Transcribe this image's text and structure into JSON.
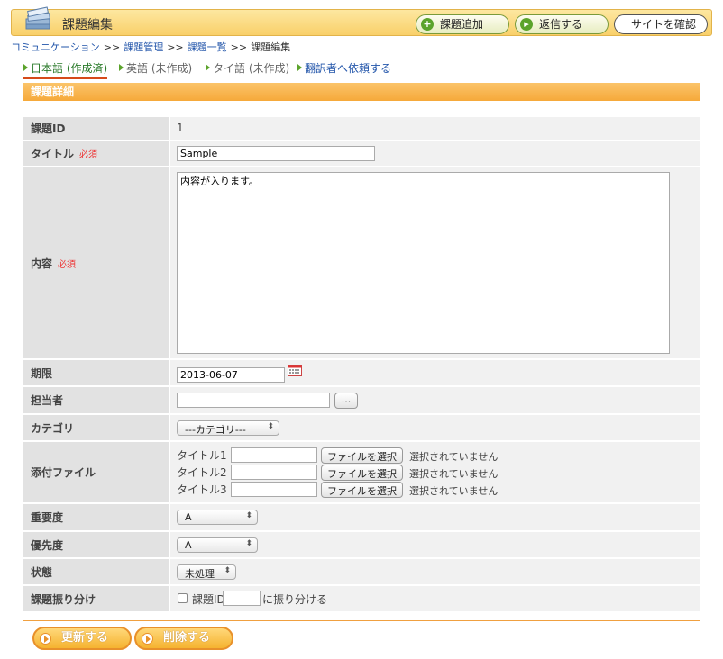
{
  "header": {
    "title": "課題編集",
    "buttons": {
      "add_task": "課題追加",
      "reply": "返信する",
      "view_site": "サイトを確認"
    }
  },
  "breadcrumb": {
    "items": [
      "コミュニケーション",
      "課題管理",
      "課題一覧",
      "課題編集"
    ],
    "separator": ">>"
  },
  "tabs": [
    {
      "label": "日本語 (作成済)"
    },
    {
      "label": "英語 (未作成)"
    },
    {
      "label": "タイ語 (未作成)"
    },
    {
      "label": "翻訳者へ依頼する"
    }
  ],
  "section": {
    "title": "課題詳細"
  },
  "form": {
    "required_mark": "必須",
    "task_id": {
      "label": "課題ID",
      "value": "1"
    },
    "title": {
      "label": "タイトル",
      "value": "Sample"
    },
    "content": {
      "label": "内容",
      "value": "内容が入ります。"
    },
    "deadline": {
      "label": "期限",
      "value": "2013-06-07"
    },
    "assignee": {
      "label": "担当者",
      "value": "",
      "button": "..."
    },
    "category": {
      "label": "カテゴリ",
      "value": "---カテゴリ---"
    },
    "attachments": {
      "label": "添付ファイル",
      "choose_button": "ファイルを選択",
      "no_file": "選択されていません",
      "items": [
        "タイトル1",
        "タイトル2",
        "タイトル3"
      ]
    },
    "importance": {
      "label": "重要度",
      "value": "A"
    },
    "priority": {
      "label": "優先度",
      "value": "A"
    },
    "status": {
      "label": "状態",
      "value": "未処理"
    },
    "assign": {
      "label": "課題振り分け",
      "prefix": "課題ID",
      "suffix": "に振り分ける"
    }
  },
  "footer": {
    "update": "更新する",
    "delete": "削除する"
  },
  "colors": {
    "header_bg": "#f9d06a",
    "accent_orange": "#f6a93a",
    "required_red": "#ee3333",
    "link_blue": "#2255aa",
    "icon_green": "#5ba32b"
  }
}
